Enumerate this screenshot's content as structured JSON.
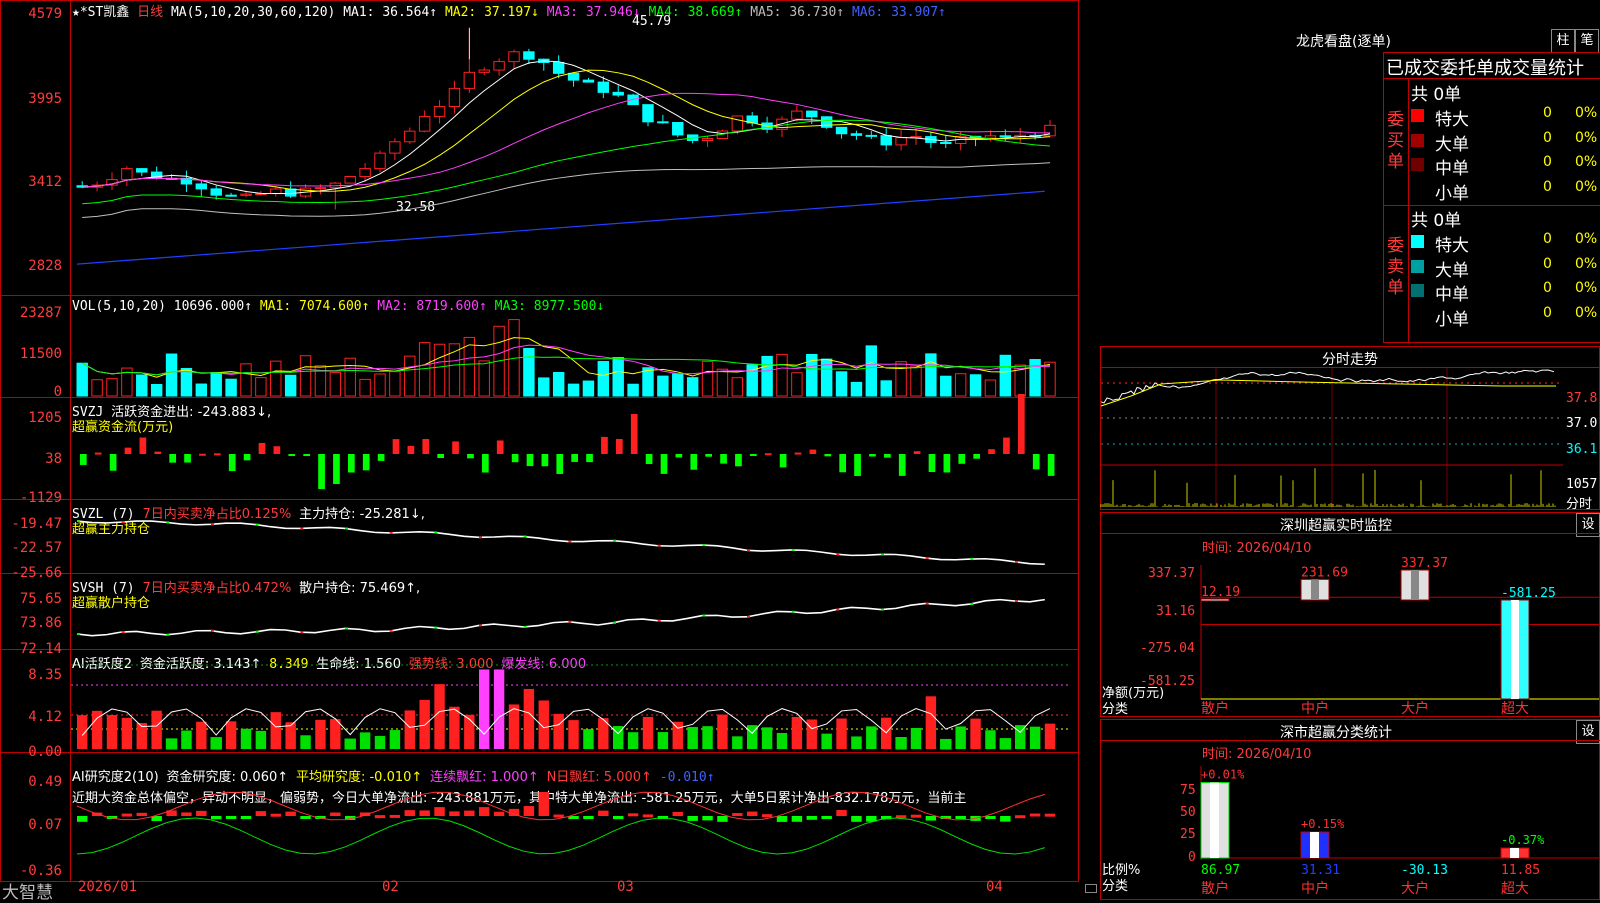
{
  "colors": {
    "up": "#ff2020",
    "down": "#00ffff",
    "border": "#c00000",
    "ma1": "#ffffff",
    "ma2": "#ffff00",
    "ma3": "#ff40ff",
    "ma4": "#00ff00",
    "ma5": "#c0c0c0",
    "ma6": "#2040ff"
  },
  "kline": {
    "stock": "★*ST凯鑫",
    "period": "日线",
    "ma_params": "MA(5,10,20,30,60,120)",
    "ma1": "MA1: 36.564↑",
    "ma2": "MA2: 37.197↓",
    "ma3": "MA3: 37.946↓",
    "ma4": "MA4: 38.669↑",
    "ma5": "MA5: 36.730↑",
    "ma6": "MA6: 33.907↑",
    "y_labels": [
      "4579",
      "3995",
      "3412",
      "2828"
    ],
    "high_mark": "45.79",
    "low_mark": "32.58"
  },
  "vol": {
    "title": "VOL(5,10,20)",
    "val": "10696.000↑",
    "ma1": "MA1: 7074.600↑",
    "ma2": "MA2: 8719.600↑",
    "ma3": "MA3: 8977.500↓",
    "y_labels": [
      "23287",
      "11500",
      "0"
    ]
  },
  "svzj": {
    "title": "SVZJ",
    "desc": "活跃资金进出: -243.883↓,",
    "sub": "超赢资金流(万元)",
    "y_labels": [
      "1205",
      "38",
      "-1129"
    ]
  },
  "svzl": {
    "title": "SVZL (7)",
    "desc1": "7日内买卖净占比0.125%",
    "desc2": "主力持仓: -25.281↓,",
    "sub": "超赢主力持仓",
    "y_labels": [
      "-19.47",
      "-22.57",
      "-25.66"
    ]
  },
  "svsh": {
    "title": "SVSH (7)",
    "desc1": "7日内买卖净占比0.472%",
    "desc2": "散户持仓: 75.469↑,",
    "sub": "超赢散户持仓",
    "y_labels": [
      "75.65",
      "73.86",
      "72.14"
    ]
  },
  "ai1": {
    "title": "AI活跃度2",
    "a": "资金活跃度: 3.143↑",
    "b": "8.349",
    "c": "生命线: 1.560",
    "d": "强势线: 3.000",
    "e": "爆发线: 6.000",
    "y_labels": [
      "8.35",
      "4.12",
      "0.00"
    ]
  },
  "ai2": {
    "title": "AI研究度2(10)",
    "a": "资金研究度: 0.060↑",
    "b": "平均研究度: -0.010↑",
    "c": "连续飘红: 1.000↑",
    "d": "N日飘红: 5.000↑",
    "e": "-0.010↑",
    "comment": "近期大资金总体偏空，异动不明显，偏弱势，今日大单净流出: -243.881万元，其中特大单净流出: -581.25万元，大单5日累计净出-832.178万元，当前主",
    "y_labels": [
      "0.49",
      "0.07",
      "-0.36"
    ]
  },
  "xaxis": {
    "labels": [
      "2026/01",
      "02",
      "03",
      "04"
    ]
  },
  "brand": "大智慧",
  "lhb": {
    "title": "龙虎看盘(逐单)",
    "btn1": "柱",
    "btn2": "笔",
    "header": "已成交委托单成交量统计",
    "buy_label": "委买单",
    "sell_label": "委卖单",
    "buy_total": "共 0单",
    "sell_total": "共 0单",
    "buy_rows": [
      {
        "name": "特大",
        "v": "0",
        "p": "0%",
        "color": "#ff0000"
      },
      {
        "name": "大单",
        "v": "0",
        "p": "0%",
        "color": "#a00000"
      },
      {
        "name": "中单",
        "v": "0",
        "p": "0%",
        "color": "#700000"
      },
      {
        "name": "小单",
        "v": "0",
        "p": "0%",
        "color": ""
      }
    ],
    "sell_rows": [
      {
        "name": "特大",
        "v": "0",
        "p": "0%",
        "color": "#00ffff"
      },
      {
        "name": "大单",
        "v": "0",
        "p": "0%",
        "color": "#00a0a0"
      },
      {
        "name": "中单",
        "v": "0",
        "p": "0%",
        "color": "#007070"
      },
      {
        "name": "小单",
        "v": "0",
        "p": "0%",
        "color": ""
      }
    ]
  },
  "intraday": {
    "title": "分时走势",
    "y_labels": [
      "37.8",
      "37.0",
      "36.1"
    ],
    "vol_label": "1057",
    "unit": "分时"
  },
  "sz_monitor": {
    "title": "深圳超赢实时监控",
    "settings": "设",
    "time": "时间: 2026/04/10",
    "y_labels": [
      "337.37",
      "31.16",
      "-275.04",
      "-581.25"
    ],
    "bars": [
      {
        "name": "散户",
        "value": 12.19,
        "label": "12.19"
      },
      {
        "name": "中户",
        "value": 231.69,
        "label": "231.69"
      },
      {
        "name": "大户",
        "value": 337.37,
        "label": "337.37"
      },
      {
        "name": "超大",
        "value": -581.25,
        "label": "-581.25"
      }
    ],
    "ylabel": "净额(万元)",
    "xlabel": "分类"
  },
  "sz_class": {
    "title": "深市超赢分类统计",
    "settings": "设",
    "time": "时间: 2026/04/10",
    "y_labels": [
      "75",
      "50",
      "25",
      "0"
    ],
    "bars": [
      {
        "name": "散户",
        "value": 86.97,
        "label": "86.97",
        "pct": "+0.01%"
      },
      {
        "name": "中户",
        "value": 31.31,
        "label": "31.31",
        "pct": "+0.15%"
      },
      {
        "name": "大户",
        "value": -30.13,
        "label": "-30.13",
        "pct": ""
      },
      {
        "name": "超大",
        "value": 11.85,
        "label": "11.85",
        "pct": "-0.37%"
      }
    ],
    "ylabel": "比例%",
    "xlabel": "分类"
  }
}
